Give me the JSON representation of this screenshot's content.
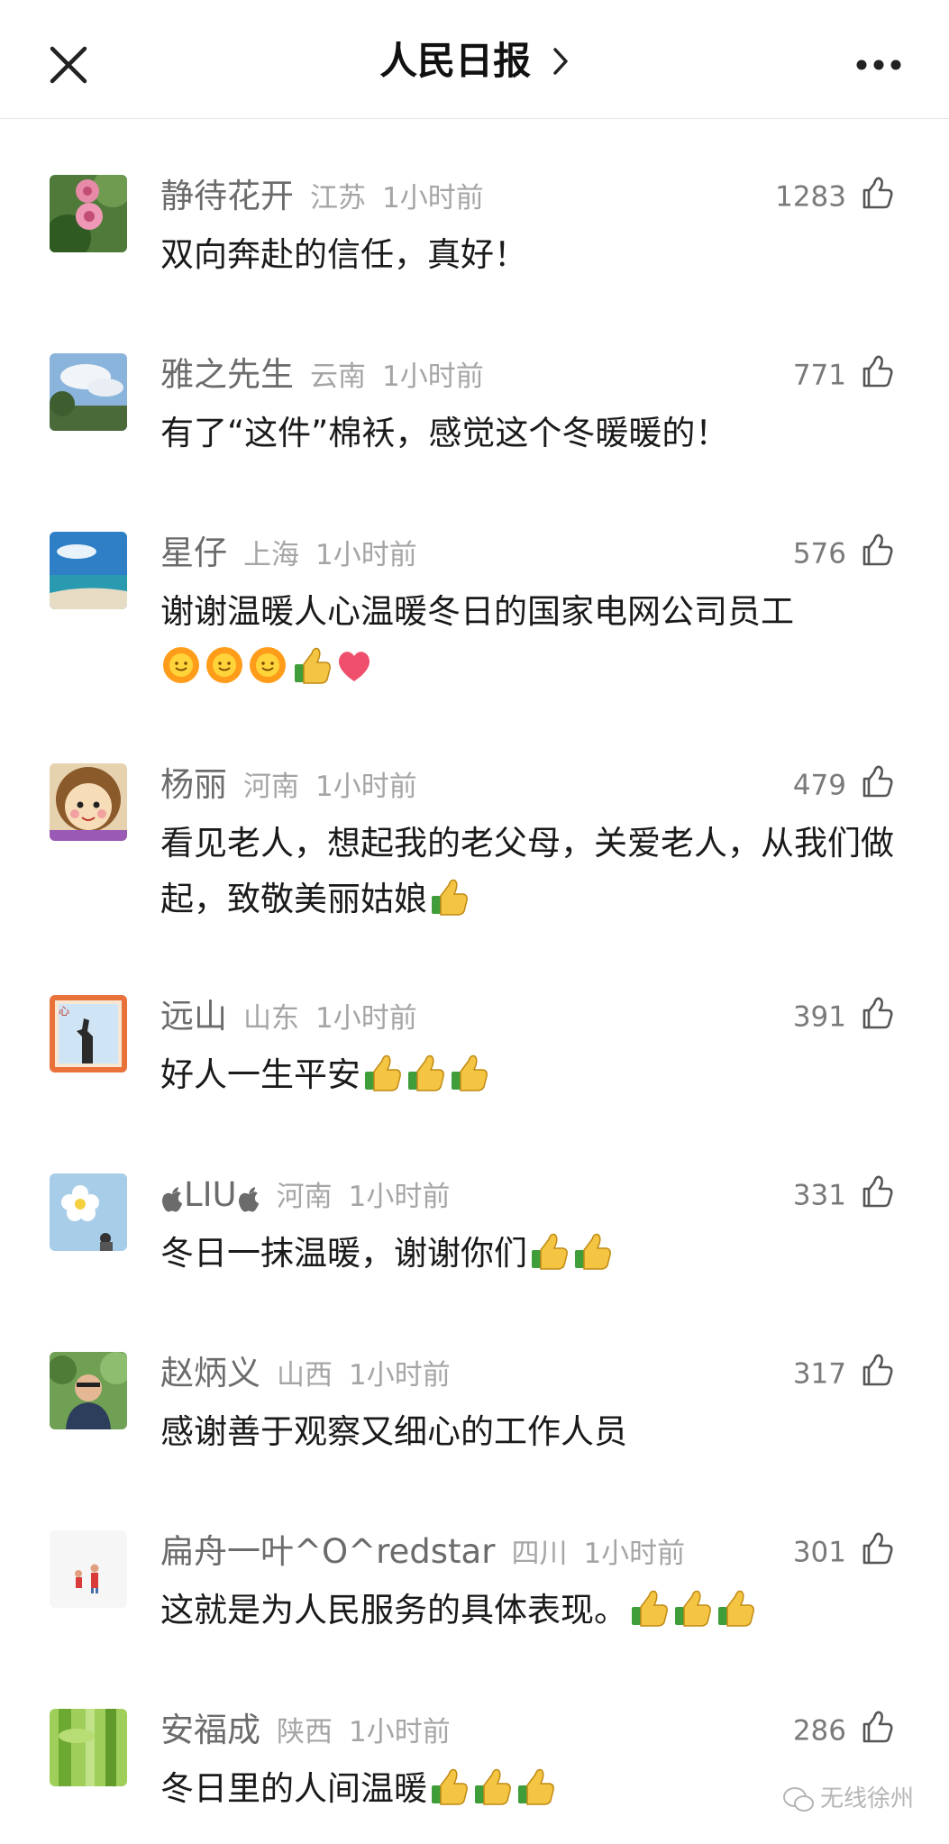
{
  "header": {
    "title": "人民日报"
  },
  "comments": [
    {
      "nickname": "静待花开",
      "location": "江苏",
      "time": "1小时前",
      "likes": "1283",
      "text": "双向奔赴的信任，真好！",
      "emojis": []
    },
    {
      "nickname": "雅之先生",
      "location": "云南",
      "time": "1小时前",
      "likes": "771",
      "text": "有了“这件”棉袄，感觉这个冬暖暖的！",
      "emojis": []
    },
    {
      "nickname": "星仔",
      "location": "上海",
      "time": "1小时前",
      "likes": "576",
      "text": "谢谢温暖人心温暖冬日的国家电网公司员工",
      "emojis": [
        "sun-emoji",
        "sun-emoji",
        "sun-emoji",
        "thumbs-up-emoji",
        "heart-emoji"
      ]
    },
    {
      "nickname": "杨丽",
      "location": "河南",
      "time": "1小时前",
      "likes": "479",
      "text": "看见老人，想起我的老父母，关爱老人，从我们做起，致敬美丽姑娘",
      "emojis": [
        "thumbs-up-emoji"
      ]
    },
    {
      "nickname": "远山",
      "location": "山东",
      "time": "1小时前",
      "likes": "391",
      "text": "好人一生平安",
      "emojis": [
        "thumbs-up-emoji",
        "thumbs-up-emoji",
        "thumbs-up-emoji"
      ]
    },
    {
      "nickname": "LIU",
      "location": "河南",
      "time": "1小时前",
      "likes": "331",
      "text": "冬日一抹温暖，谢谢你们",
      "emojis": [
        "thumbs-up-emoji",
        "thumbs-up-emoji"
      ]
    },
    {
      "nickname": "赵炳义",
      "location": "山西",
      "time": "1小时前",
      "likes": "317",
      "text": "感谢善于观察又细心的工作人员",
      "emojis": []
    },
    {
      "nickname": "扁舟一叶^O^redstar",
      "location": "四川",
      "time": "1小时前",
      "likes": "301",
      "text": "这就是为人民服务的具体表现。",
      "emojis": [
        "thumbs-up-emoji",
        "thumbs-up-emoji",
        "thumbs-up-emoji"
      ]
    },
    {
      "nickname": "安福成",
      "location": "陕西",
      "time": "1小时前",
      "likes": "286",
      "text": "冬日里的人间温暖",
      "emojis": [
        "thumbs-up-emoji",
        "thumbs-up-emoji",
        "thumbs-up-emoji"
      ]
    }
  ],
  "watermark": {
    "text": "无线徐州"
  }
}
